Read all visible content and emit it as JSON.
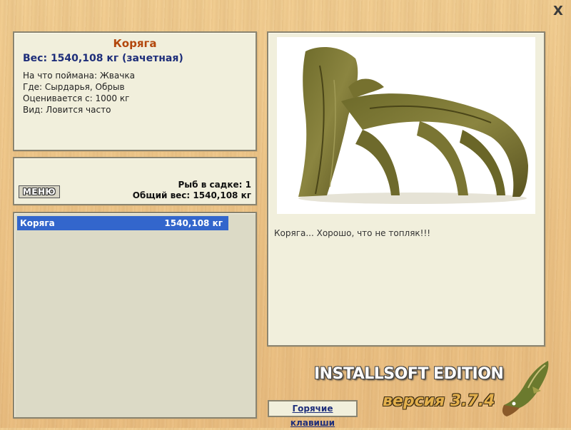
{
  "window": {
    "close_symbol": "X"
  },
  "info": {
    "title": "Коряга",
    "weight": "Вес: 1540,108 кг (зачетная)",
    "lines": [
      "На что поймана: Жвачка",
      "Где: Сырдарья, Обрыв",
      "Оценивается с: 1000 кг",
      "Вид: Ловится часто"
    ]
  },
  "stats": {
    "menu_label": "МЕНЮ",
    "fish_count": "Рыб в садке: 1",
    "total_weight": "Общий вес: 1540,108 кг"
  },
  "list": {
    "rows": [
      {
        "name": "Коряга",
        "weight": "1540,108 кг"
      }
    ]
  },
  "image": {
    "caption": "Коряга... Хорошо, что не топляк!!!"
  },
  "footer": {
    "hotkeys_label": "Горячие клавиши",
    "edition": "INSTALLSOFT EDITION",
    "version": "версия 3.7.4"
  },
  "icons": {
    "close": "close-icon",
    "fish_logo": "pike-logo-icon"
  }
}
